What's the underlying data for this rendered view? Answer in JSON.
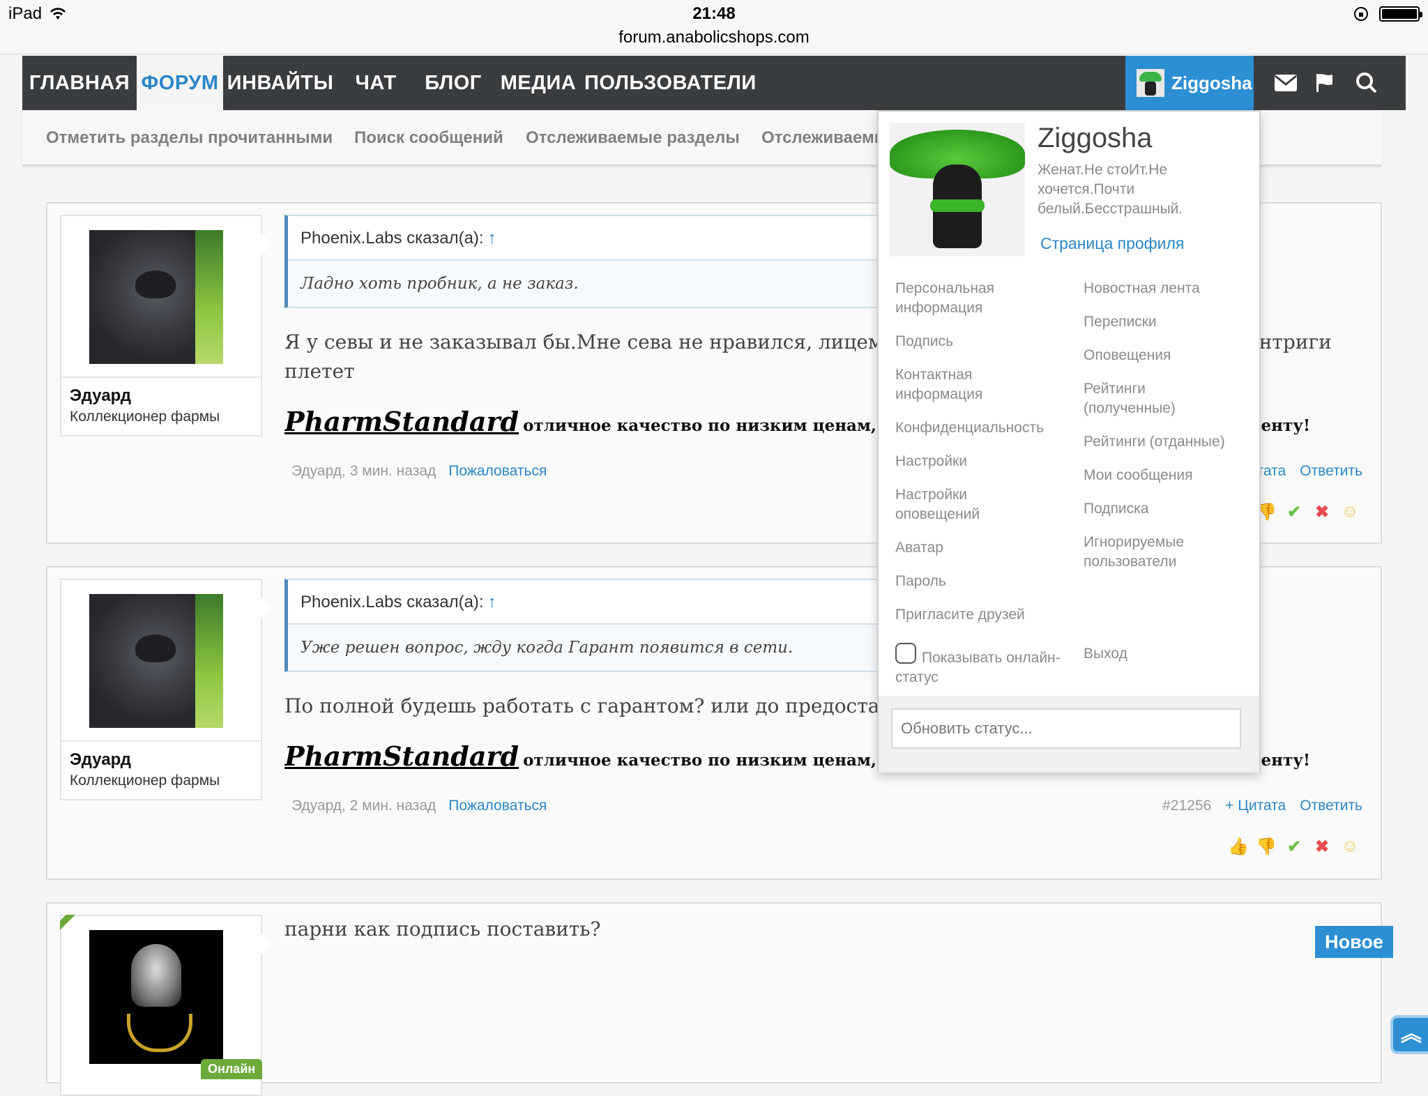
{
  "statusbar": {
    "device": "iPad",
    "time": "21:48",
    "url": "forum.anabolicshops.com"
  },
  "nav": {
    "items": [
      "ГЛАВНАЯ",
      "ФОРУМ",
      "ИНВАЙТЫ",
      "ЧАТ",
      "БЛОГ",
      "МЕДИА",
      "ПОЛЬЗОВАТЕЛИ"
    ],
    "active": "ФОРУМ",
    "user": "Ziggosha"
  },
  "subnav": [
    "Отметить разделы прочитанными",
    "Поиск сообщений",
    "Отслеживаемые разделы",
    "Отслеживаемые"
  ],
  "posts": [
    {
      "author": "Эдуард",
      "author_title": "Коллекционер фармы",
      "quote_author": "Phoenix.Labs сказал(а):",
      "quote_arrow": "↑",
      "quote_text": "Ладно хоть пробник, а не заказ.",
      "message": "Я у севы и не заказывал бы.Мне сева не нравился, лицемерный, скрины эти показал где он интриги плетет",
      "sig_brand": "PharmStandard",
      "sig_slogan": "отличное качество по низким ценам, индивидуальный подход к каждому клиенту!",
      "meta_author": "Эдуард,",
      "meta_time": "3 мин. назад",
      "report": "Пожаловаться",
      "post_num": "",
      "quote_btn": "+ Цитата",
      "reply_btn": "Ответить"
    },
    {
      "author": "Эдуард",
      "author_title": "Коллекционер фармы",
      "quote_author": "Phoenix.Labs сказал(а):",
      "quote_arrow": "↑",
      "quote_text": "Уже решен вопрос, жду когда Гарант появится в сети.",
      "message": "По полной будешь работать с гарантом? или до предоставления треков?",
      "sig_brand": "PharmStandard",
      "sig_slogan": "отличное качество по низким ценам, индивидуальный подход к каждому клиенту!",
      "meta_author": "Эдуард,",
      "meta_time": "2 мин. назад",
      "report": "Пожаловаться",
      "post_num": "#21256",
      "quote_btn": "+ Цитата",
      "reply_btn": "Ответить"
    },
    {
      "message": "парни как подпись поставить?",
      "online_badge": "Онлайн"
    }
  ],
  "new_badge": "Новое",
  "dropdown": {
    "name": "Ziggosha",
    "bio": "Женат.Не стоИт.Не хочется.Почти белый.Бесстрашный.",
    "profile_link": "Страница профиля",
    "left_links": [
      "Персональная информация",
      "Подпись",
      "Контактная информация",
      "Конфиденциальность",
      "Настройки",
      "Настройки оповещений",
      "Аватар",
      "Пароль",
      "Пригласите друзей"
    ],
    "right_links": [
      "Новостная лента",
      "Переписки",
      "Оповещения",
      "Рейтинги (полученные)",
      "Рейтинги (отданные)",
      "Мои сообщения",
      "Подписка",
      "Игнорируемые пользователи"
    ],
    "show_online": "Показывать онлайн-статус",
    "logout": "Выход",
    "status_placeholder": "Обновить статус..."
  },
  "colors": {
    "nav_bg": "#3a3d40",
    "accent": "#2c8fd4",
    "link": "#2a86c8",
    "online": "#6cab3a"
  }
}
